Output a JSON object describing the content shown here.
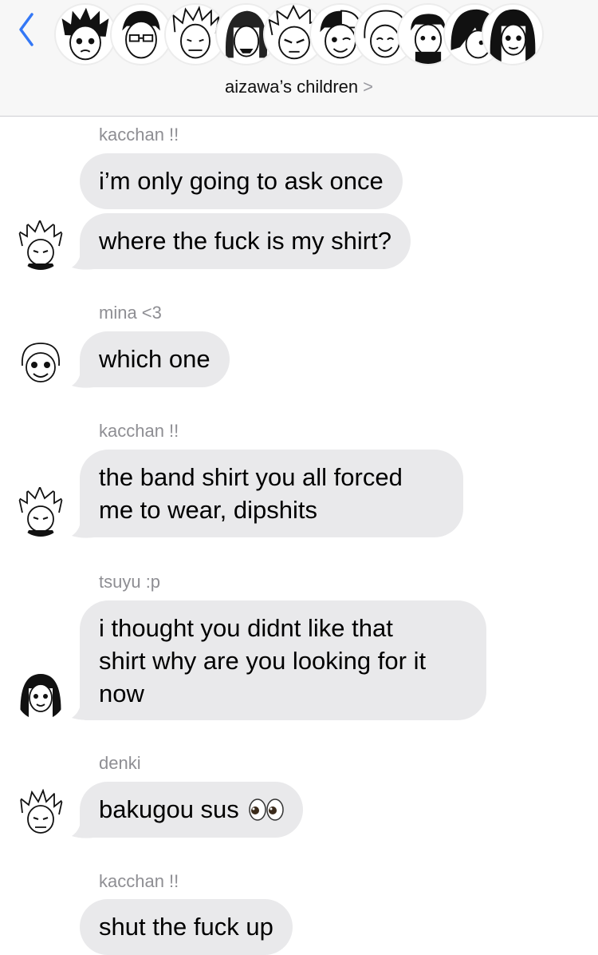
{
  "header": {
    "back_icon": "chevron-left-icon",
    "group_name": "aizawa’s children",
    "chevron": ">",
    "accent_color": "#3478f6",
    "participants": [
      "participant-1",
      "participant-2",
      "participant-3",
      "participant-4",
      "participant-5",
      "participant-6",
      "participant-7",
      "participant-8",
      "participant-9",
      "participant-10"
    ]
  },
  "messages": [
    {
      "sender": "kacchan !!",
      "lines": [
        "i’m only going to ask once"
      ]
    },
    {
      "sender": "",
      "lines": [
        "where the fuck is my shirt?"
      ]
    },
    {
      "sender": "mina <3",
      "lines": [
        "which one"
      ]
    },
    {
      "sender": "kacchan !!",
      "lines": [
        "the band shirt you all forced",
        "me to wear, dipshits"
      ]
    },
    {
      "sender": "tsuyu :p",
      "lines": [
        "i thought you didnt like that",
        "shirt why are you looking for it",
        "now"
      ]
    },
    {
      "sender": "denki",
      "lines": [
        "bakugou sus"
      ],
      "emoji": "eyes-emoji"
    },
    {
      "sender": "kacchan !!",
      "lines": [
        "shut the fuck up"
      ]
    }
  ],
  "colors": {
    "bubble": "#e9e9eb",
    "sender_label": "#8e8e93",
    "header_bg": "#f7f7f7"
  }
}
